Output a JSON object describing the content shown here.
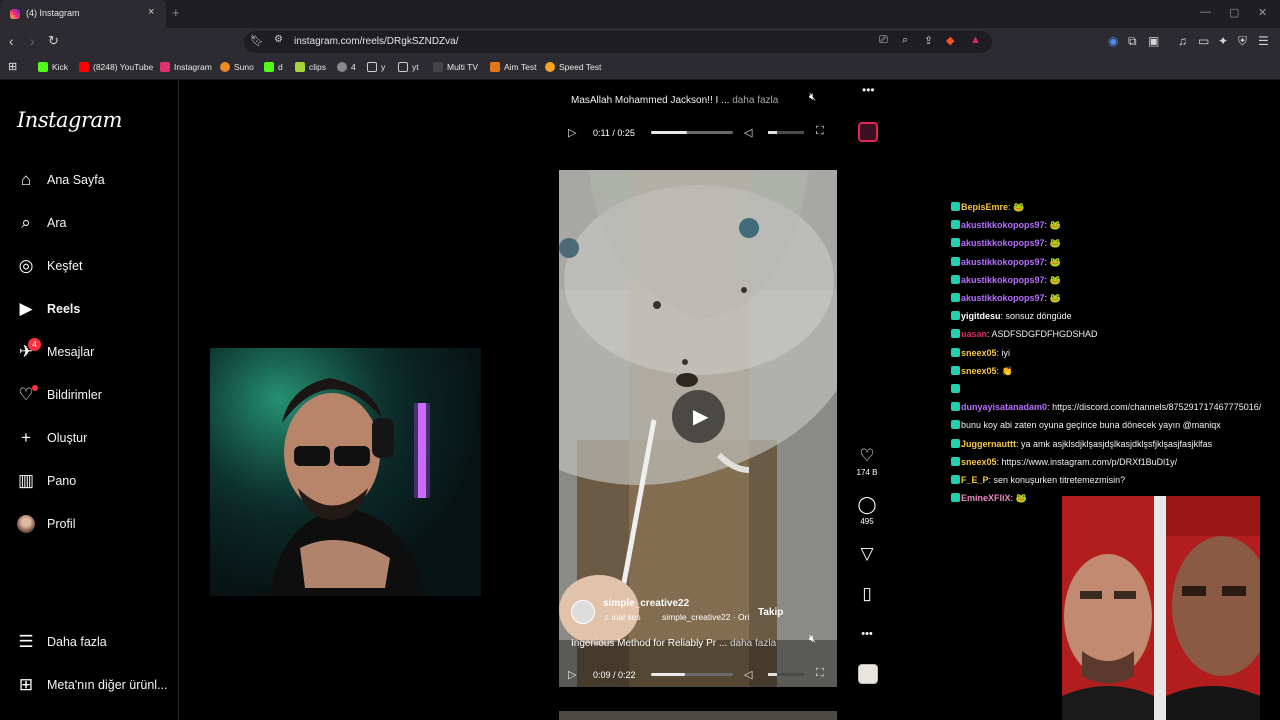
{
  "browser": {
    "tab_title": "(4) Instagram",
    "tab_close": "×",
    "new_tab": "+",
    "url": "instagram.com/reels/DRgkSZNDZva/",
    "bookmarks": [
      "Kick",
      "(8248) YouTube",
      "Instagram",
      "Suno",
      "d",
      "clips",
      "4",
      "y",
      "yt",
      "Multi TV",
      "Aim Test",
      "Speed Test"
    ]
  },
  "instagram": {
    "logo": "Instagram",
    "nav": [
      {
        "label": "Ana Sayfa",
        "icon": "home-icon"
      },
      {
        "label": "Ara",
        "icon": "search-icon"
      },
      {
        "label": "Keşfet",
        "icon": "compass-icon"
      },
      {
        "label": "Reels",
        "icon": "reels-icon"
      },
      {
        "label": "Mesajlar",
        "icon": "messenger-icon",
        "badge": "4"
      },
      {
        "label": "Bildirimler",
        "icon": "heart-icon"
      },
      {
        "label": "Oluştur",
        "icon": "plus-icon"
      },
      {
        "label": "Pano",
        "icon": "dashboard-icon"
      },
      {
        "label": "Profil",
        "icon": "profile-avatar"
      }
    ],
    "more": "Daha fazla",
    "meta": "Meta'nın diğer ürünl..."
  },
  "reel_top": {
    "caption": "MasAllah Mohammed Jackson!! I ...",
    "more": "daha fazla",
    "time": "0:11 / 0:25",
    "progress": 0.44,
    "volume": 0.25
  },
  "reel_main": {
    "author": "simple_creative22",
    "follow": "Takip",
    "audio_left": "inal ses",
    "audio_right": "simple_creative22 · Ori",
    "caption": "Ingenious Method for Reliably Pr ...",
    "more": "daha fazla",
    "time": "0:09 / 0:22",
    "progress": 0.41,
    "volume": 0.25,
    "likes": "174 B",
    "comments": "495"
  },
  "chat": [
    {
      "user": "BepisEmre",
      "color": "#f5c542",
      "msg": "🐸"
    },
    {
      "user": "akustikkokopops97",
      "color": "#b66dff",
      "msg": "🐸"
    },
    {
      "user": "akustikkokopops97",
      "color": "#b66dff",
      "msg": "🐸"
    },
    {
      "user": "akustikkokopops97",
      "color": "#b66dff",
      "msg": "🐸"
    },
    {
      "user": "akustikkokopops97",
      "color": "#b66dff",
      "msg": "🐸"
    },
    {
      "user": "akustikkokopops97",
      "color": "#b66dff",
      "msg": "🐸"
    },
    {
      "user": "yigitdesu",
      "color": "#ffffff",
      "msg": "sonsuz döngüde"
    },
    {
      "user": "uasan",
      "color": "#e0245e",
      "msg": "ASDFSDGFDFHGDSHAD"
    },
    {
      "user": "sneex05",
      "color": "#f5c542",
      "msg": "iyi"
    },
    {
      "user": "sneex05",
      "color": "#f5c542",
      "msg": "👏"
    },
    {
      "user": "",
      "color": "#f5c542",
      "msg": ""
    },
    {
      "user": "dunyayisatanadam0",
      "color": "#b66dff",
      "msg": "https://discord.com/channels/875291717467775016/"
    },
    {
      "user": "",
      "color": "#ffffff",
      "msg": "bunu koy abi zaten oyuna geçince buna dönecek yayın @maniqx"
    },
    {
      "user": "Juggernauttt",
      "color": "#f5c542",
      "msg": "ya amk asjklsdjklşasjdşlkasjdklşsfjklşasjfasjklfas"
    },
    {
      "user": "sneex05",
      "color": "#f5c542",
      "msg": "https://www.instagram.com/p/DRXf1BuDl1y/"
    },
    {
      "user": "F_E_P",
      "color": "#f5c542",
      "msg": "sen konuşurken titretemezmisin?"
    },
    {
      "user": "EmineXFliX",
      "color": "#e58ac2",
      "msg": "🐸"
    }
  ]
}
